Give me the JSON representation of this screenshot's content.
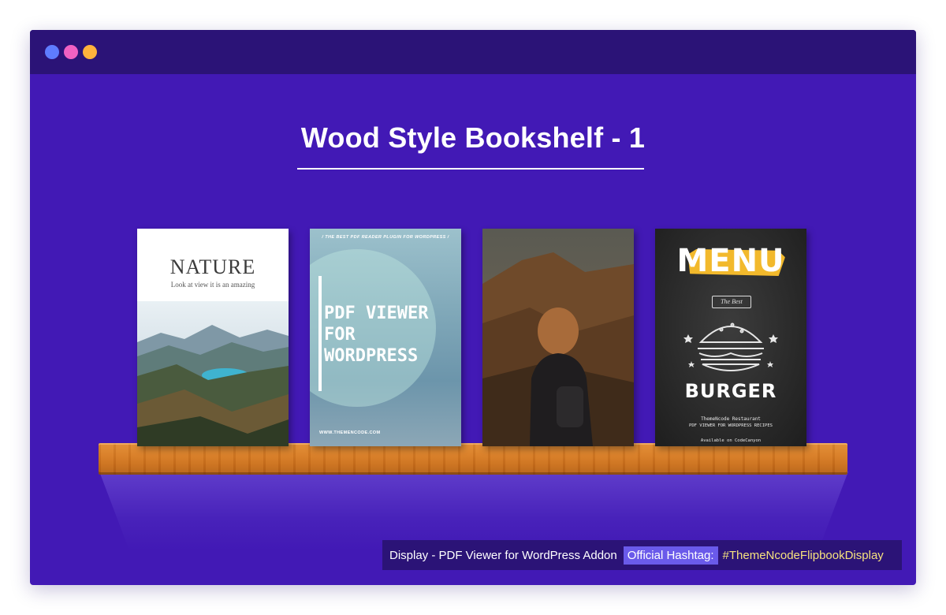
{
  "window": {
    "dot_colors": [
      "#5f7cff",
      "#f061c3",
      "#ffb23c"
    ]
  },
  "page": {
    "title": "Wood Style Bookshelf - 1"
  },
  "books": [
    {
      "name": "nature",
      "title": "NATURE",
      "subtitle": "Look at view it is an amazing"
    },
    {
      "name": "pdf-viewer",
      "tagline": "/ THE BEST PDF READER PLUGIN FOR WORDPRESS /",
      "title": "PDF VIEWER FOR WORDPRESS",
      "website": "WWW.THEMENCODE.COM"
    },
    {
      "name": "hiker"
    },
    {
      "name": "menu",
      "title": "MENU",
      "ribbon": "The Best",
      "item": "BURGER",
      "line1": "ThemeNcode Restaurant",
      "line2": "PDF VIEWER FOR WORDPRESS RECIPES",
      "availability": "Available on CodeCanyon"
    }
  ],
  "footer": {
    "lead": "Display - PDF Viewer for WordPress Addon",
    "pill": "Official Hashtag:",
    "hashtag": "#ThemeNcodeFlipbookDisplay"
  },
  "colors": {
    "window_bg": "#4219b5",
    "titlebar_bg": "#2b1377",
    "shelf_wood": "#d77b24",
    "hashtag": "#f6e27e",
    "pill_bg": "#6a5aea"
  }
}
